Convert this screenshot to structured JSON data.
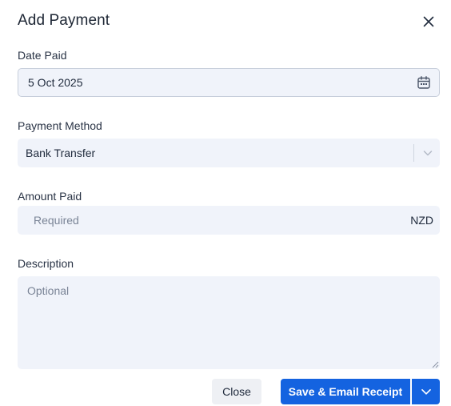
{
  "dialog": {
    "title": "Add Payment"
  },
  "date_paid": {
    "label": "Date Paid",
    "value": "5 Oct 2025"
  },
  "payment_method": {
    "label": "Payment Method",
    "value": "Bank Transfer"
  },
  "amount_paid": {
    "label": "Amount Paid",
    "placeholder": "Required",
    "currency": "NZD"
  },
  "description": {
    "label": "Description",
    "placeholder": "Optional"
  },
  "footer": {
    "close_label": "Close",
    "primary_label": "Save & Email Receipt"
  },
  "icons": {
    "close": "close-icon",
    "calendar": "calendar-icon",
    "select_chevron": "chevron-down-icon",
    "primary_dropdown": "chevron-down-icon"
  },
  "colors": {
    "primary": "#1463e0",
    "field_background": "#f0f3fa"
  }
}
